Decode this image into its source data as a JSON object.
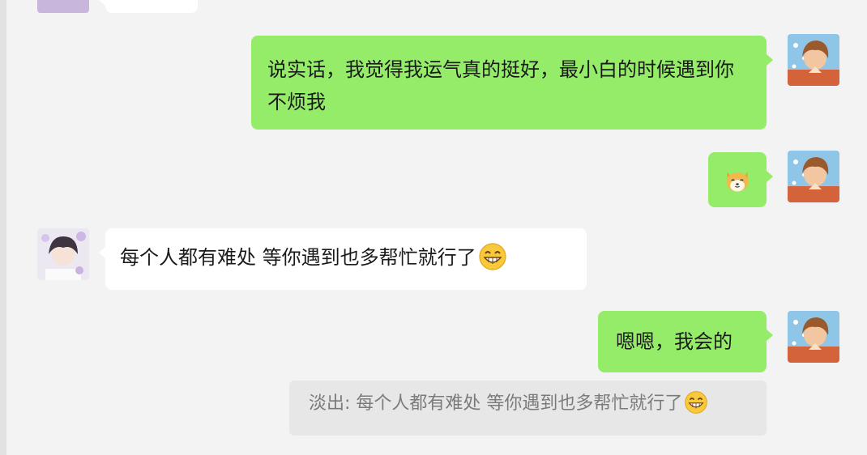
{
  "colors": {
    "background": "#f3f3f3",
    "outgoing_bubble": "#95ec69",
    "incoming_bubble": "#ffffff",
    "quote_bg": "#e7e7e7",
    "quote_text": "#7b7b7b"
  },
  "messages": [
    {
      "sender": "me",
      "text": "说实话，我觉得我运气真的挺好，最小白的时候遇到你不烦我"
    },
    {
      "sender": "me",
      "sticker": "shiba-dog-emoji"
    },
    {
      "sender": "other",
      "text": "每个人都有难处 等你遇到也多帮忙就行了",
      "emoji": "grin-emoji"
    },
    {
      "sender": "me",
      "text": "嗯嗯，我会的"
    }
  ],
  "quote": {
    "prefix": "淡出:",
    "text": "每个人都有难处 等你遇到也多帮忙就行了",
    "emoji": "grin-emoji"
  }
}
